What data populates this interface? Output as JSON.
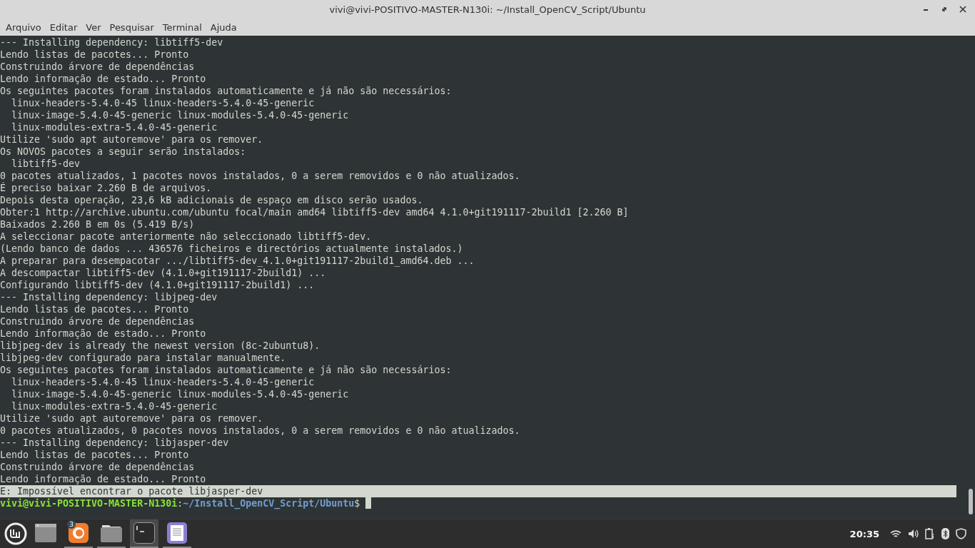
{
  "window": {
    "title": "vivi@vivi-POSITIVO-MASTER-N130i: ~/Install_OpenCV_Script/Ubuntu"
  },
  "menu": [
    "Arquivo",
    "Editar",
    "Ver",
    "Pesquisar",
    "Terminal",
    "Ajuda"
  ],
  "terminal": {
    "lines": [
      {
        "text": "--- Installing dependency: libtiff5-dev",
        "highlighted": false
      },
      {
        "text": "Lendo listas de pacotes... Pronto",
        "highlighted": false
      },
      {
        "text": "Construindo árvore de dependências",
        "highlighted": false
      },
      {
        "text": "Lendo informação de estado... Pronto",
        "highlighted": false
      },
      {
        "text": "Os seguintes pacotes foram instalados automaticamente e já não são necessários:",
        "highlighted": false
      },
      {
        "text": "  linux-headers-5.4.0-45 linux-headers-5.4.0-45-generic",
        "highlighted": false
      },
      {
        "text": "  linux-image-5.4.0-45-generic linux-modules-5.4.0-45-generic",
        "highlighted": false
      },
      {
        "text": "  linux-modules-extra-5.4.0-45-generic",
        "highlighted": false
      },
      {
        "text": "Utilize 'sudo apt autoremove' para os remover.",
        "highlighted": false
      },
      {
        "text": "Os NOVOS pacotes a seguir serão instalados:",
        "highlighted": false
      },
      {
        "text": "  libtiff5-dev",
        "highlighted": false
      },
      {
        "text": "0 pacotes atualizados, 1 pacotes novos instalados, 0 a serem removidos e 0 não atualizados.",
        "highlighted": false
      },
      {
        "text": "É preciso baixar 2.260 B de arquivos.",
        "highlighted": false
      },
      {
        "text": "Depois desta operação, 23,6 kB adicionais de espaço em disco serão usados.",
        "highlighted": false
      },
      {
        "text": "Obter:1 http://archive.ubuntu.com/ubuntu focal/main amd64 libtiff5-dev amd64 4.1.0+git191117-2build1 [2.260 B]",
        "highlighted": false
      },
      {
        "text": "Baixados 2.260 B em 0s (5.419 B/s)",
        "highlighted": false
      },
      {
        "text": "A seleccionar pacote anteriormente não seleccionado libtiff5-dev.",
        "highlighted": false
      },
      {
        "text": "(Lendo banco de dados ... 436576 ficheiros e directórios actualmente instalados.)",
        "highlighted": false
      },
      {
        "text": "A preparar para desempacotar .../libtiff5-dev_4.1.0+git191117-2build1_amd64.deb ...",
        "highlighted": false
      },
      {
        "text": "A descompactar libtiff5-dev (4.1.0+git191117-2build1) ...",
        "highlighted": false
      },
      {
        "text": "Configurando libtiff5-dev (4.1.0+git191117-2build1) ...",
        "highlighted": false
      },
      {
        "text": "--- Installing dependency: libjpeg-dev",
        "highlighted": false
      },
      {
        "text": "Lendo listas de pacotes... Pronto",
        "highlighted": false
      },
      {
        "text": "Construindo árvore de dependências",
        "highlighted": false
      },
      {
        "text": "Lendo informação de estado... Pronto",
        "highlighted": false
      },
      {
        "text": "libjpeg-dev is already the newest version (8c-2ubuntu8).",
        "highlighted": false
      },
      {
        "text": "libjpeg-dev configurado para instalar manualmente.",
        "highlighted": false
      },
      {
        "text": "Os seguintes pacotes foram instalados automaticamente e já não são necessários:",
        "highlighted": false
      },
      {
        "text": "  linux-headers-5.4.0-45 linux-headers-5.4.0-45-generic",
        "highlighted": false
      },
      {
        "text": "  linux-image-5.4.0-45-generic linux-modules-5.4.0-45-generic",
        "highlighted": false
      },
      {
        "text": "  linux-modules-extra-5.4.0-45-generic",
        "highlighted": false
      },
      {
        "text": "Utilize 'sudo apt autoremove' para os remover.",
        "highlighted": false
      },
      {
        "text": "0 pacotes atualizados, 0 pacotes novos instalados, 0 a serem removidos e 0 não atualizados.",
        "highlighted": false
      },
      {
        "text": "--- Installing dependency: libjasper-dev",
        "highlighted": false
      },
      {
        "text": "Lendo listas de pacotes... Pronto",
        "highlighted": false
      },
      {
        "text": "Construindo árvore de dependências",
        "highlighted": false
      },
      {
        "text": "Lendo informação de estado... Pronto",
        "highlighted": false
      },
      {
        "text": "E: Impossível encontrar o pacote libjasper-dev",
        "highlighted": true
      }
    ],
    "prompt": {
      "user_host": "vivi@vivi-POSITIVO-MASTER-N130i",
      "separator": ":",
      "path": "~/Install_OpenCV_Script/Ubuntu",
      "symbol": "$"
    }
  },
  "taskbar": {
    "apps": [
      {
        "kind": "window",
        "running": false,
        "selected": false
      },
      {
        "kind": "firefox",
        "running": true,
        "selected": false,
        "badge": "3"
      },
      {
        "kind": "folder",
        "running": true,
        "selected": false
      },
      {
        "kind": "terminal",
        "running": true,
        "selected": true
      },
      {
        "kind": "editor",
        "running": true,
        "selected": false
      }
    ],
    "clock": "20:35"
  }
}
